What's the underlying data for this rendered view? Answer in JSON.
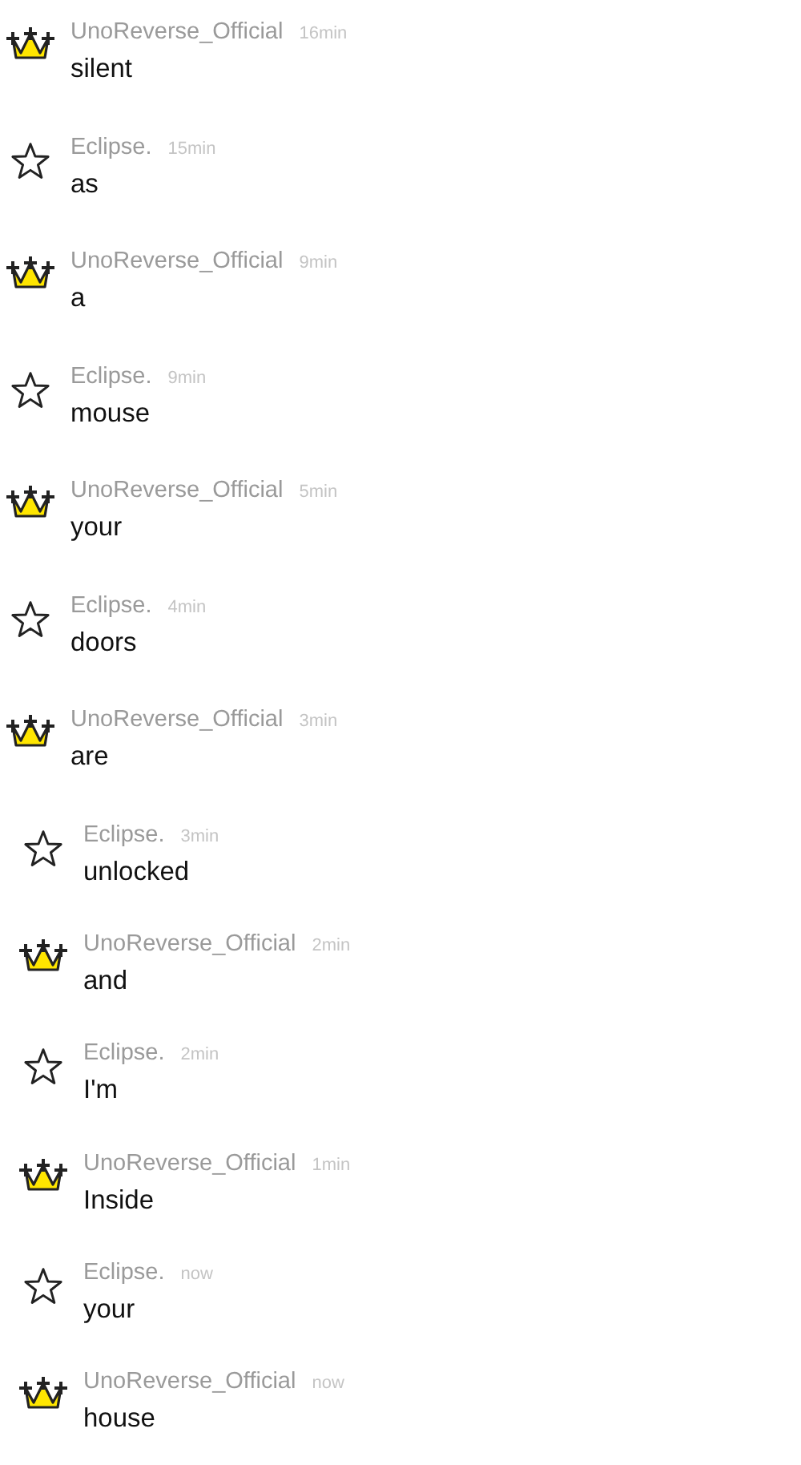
{
  "comments": [
    {
      "kind": "crown",
      "user": "UnoReverse_Official",
      "time": "16min",
      "text": "silent"
    },
    {
      "kind": "star",
      "user": "Eclipse.",
      "time": "15min",
      "text": "as"
    },
    {
      "kind": "crown",
      "user": "UnoReverse_Official",
      "time": "9min",
      "text": "a"
    },
    {
      "kind": "star",
      "user": "Eclipse.",
      "time": "9min",
      "text": "mouse"
    },
    {
      "kind": "crown",
      "user": "UnoReverse_Official",
      "time": "5min",
      "text": "your"
    },
    {
      "kind": "star",
      "user": "Eclipse.",
      "time": "4min",
      "text": "doors"
    },
    {
      "kind": "crown",
      "user": "UnoReverse_Official",
      "time": "3min",
      "text": "are",
      "children": [
        {
          "kind": "star",
          "user": "Eclipse.",
          "time": "3min",
          "text": "unlocked"
        },
        {
          "kind": "crown",
          "user": "UnoReverse_Official",
          "time": "2min",
          "text": "and"
        },
        {
          "kind": "star",
          "user": "Eclipse.",
          "time": "2min",
          "text": "I'm"
        },
        {
          "kind": "crown",
          "user": "UnoReverse_Official",
          "time": "1min",
          "text": "Inside"
        },
        {
          "kind": "star",
          "user": "Eclipse.",
          "time": "now",
          "text": "your"
        },
        {
          "kind": "crown",
          "user": "UnoReverse_Official",
          "time": "now",
          "text": "house"
        }
      ]
    }
  ]
}
